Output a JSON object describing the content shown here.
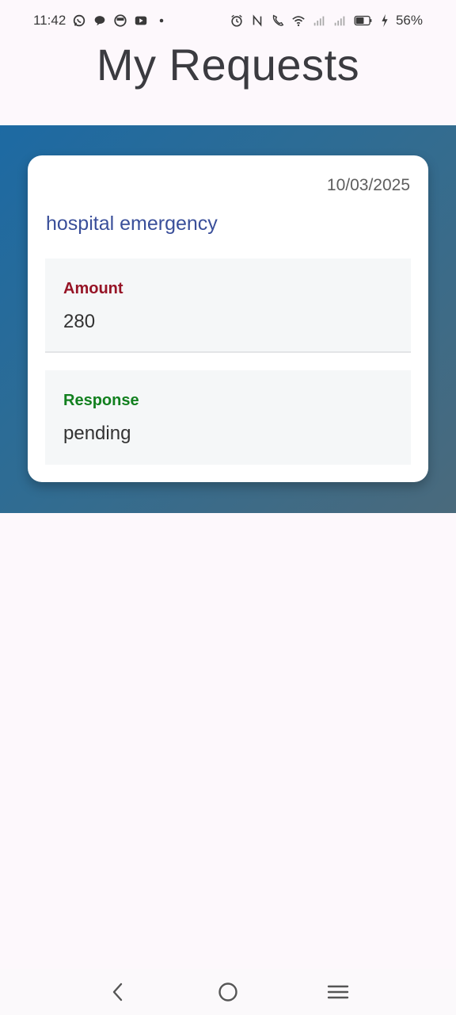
{
  "status_bar": {
    "time": "11:42",
    "battery": "56%",
    "left_icons": [
      "whatsapp-icon",
      "chat-icon",
      "app-icon",
      "youtube-icon",
      "dot-icon"
    ],
    "right_icons": [
      "alarm-icon",
      "nfc-icon",
      "volte-icon",
      "wifi-icon",
      "signal-icon",
      "signal-icon",
      "battery-icon",
      "charging-icon"
    ]
  },
  "page": {
    "title": "My Requests"
  },
  "request": {
    "date": "10/03/2025",
    "title": "hospital emergency",
    "amount_label": "Amount",
    "amount_value": "280",
    "response_label": "Response",
    "response_value": "pending"
  },
  "colors": {
    "title_color": "#3a4f9a",
    "amount_label_color": "#961426",
    "response_label_color": "#12801f",
    "hero_gradient_start": "#1d6aa3",
    "hero_gradient_end": "#4a6a7c"
  },
  "nav": {
    "icons": [
      "back-icon",
      "home-icon",
      "menu-icon"
    ]
  }
}
